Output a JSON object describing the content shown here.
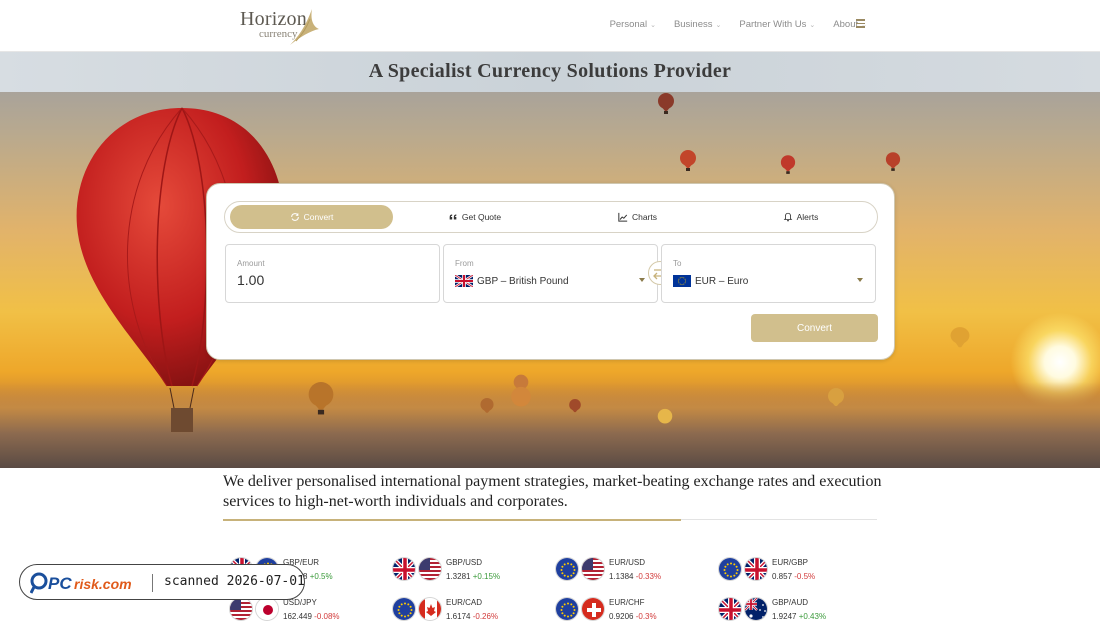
{
  "header": {
    "logo_word1": "Horizon",
    "logo_word2": "currency",
    "nav": [
      {
        "label": "Personal"
      },
      {
        "label": "Business"
      },
      {
        "label": "Partner With Us"
      },
      {
        "label": "About"
      }
    ],
    "menu_icon": "hamburger-icon"
  },
  "hero": {
    "title": "A Specialist Currency Solutions Provider"
  },
  "converter": {
    "tabs": [
      {
        "label": "Convert",
        "icon": "refresh-icon",
        "active": true
      },
      {
        "label": "Get Quote",
        "icon": "quote-icon",
        "active": false
      },
      {
        "label": "Charts",
        "icon": "chart-icon",
        "active": false
      },
      {
        "label": "Alerts",
        "icon": "bell-icon",
        "active": false
      }
    ],
    "amount_label": "Amount",
    "amount_value": "1.00",
    "from_label": "From",
    "from_value": "GBP – British Pound",
    "to_label": "To",
    "to_value": "EUR – Euro",
    "convert_label": "Convert"
  },
  "description": "We deliver personalised international payment strategies, market-beating exchange rates and execution services to high-net-worth individuals and corporates.",
  "rates": [
    {
      "pair": "GBP/EUR",
      "rate": "1.1678",
      "change": "+0.5%",
      "direction": "up",
      "flags": [
        "gb",
        "eu"
      ]
    },
    {
      "pair": "GBP/USD",
      "rate": "1.3281",
      "change": "+0.15%",
      "direction": "up",
      "flags": [
        "gb",
        "us"
      ]
    },
    {
      "pair": "EUR/USD",
      "rate": "1.1384",
      "change": "-0.33%",
      "direction": "down",
      "flags": [
        "eu",
        "us"
      ]
    },
    {
      "pair": "EUR/GBP",
      "rate": "0.857",
      "change": "-0.5%",
      "direction": "down",
      "flags": [
        "eu",
        "gb"
      ]
    },
    {
      "pair": "USD/JPY",
      "rate": "162.449",
      "change": "-0.08%",
      "direction": "down",
      "flags": [
        "us",
        "jp"
      ]
    },
    {
      "pair": "EUR/CAD",
      "rate": "1.6174",
      "change": "-0.26%",
      "direction": "down",
      "flags": [
        "eu",
        "ca"
      ]
    },
    {
      "pair": "EUR/CHF",
      "rate": "0.9206",
      "change": "-0.3%",
      "direction": "down",
      "flags": [
        "eu",
        "ch"
      ]
    },
    {
      "pair": "GBP/AUD",
      "rate": "1.9247",
      "change": "+0.43%",
      "direction": "up",
      "flags": [
        "gb",
        "au"
      ]
    }
  ],
  "colors": {
    "accent": "#d1bf8d",
    "up": "#3a9a3a",
    "down": "#d23b3b"
  },
  "watermark": {
    "brand": "PCrisk.com",
    "text": "scanned 2026-07-01"
  }
}
